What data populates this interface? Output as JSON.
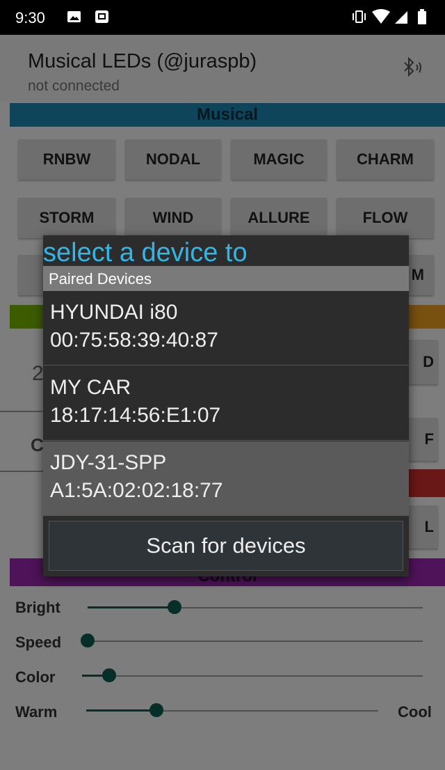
{
  "status_bar": {
    "time": "9:30"
  },
  "app": {
    "title": "Musical LEDs (@juraspb)",
    "subtitle": "not connected",
    "bluetooth_icon": "bluetooth-searching-icon"
  },
  "sections": {
    "musical": "Musical",
    "control": "Control"
  },
  "colors": {
    "musical_band": "#1f8bb5",
    "section2_band": "#7ab800",
    "section2_right": "#f0a020",
    "section3_band": "#d32f2f",
    "control_band": "#9c27b0",
    "slider_accent": "#0b5f50",
    "dialog_title": "#33b5e5"
  },
  "musical_buttons": {
    "row1": [
      "RNBW",
      "NODAL",
      "MAGIC",
      "CHARM"
    ],
    "row2": [
      "STORM",
      "WIND",
      "ALLURE",
      "FLOW"
    ],
    "row3_visible_fragment": "M"
  },
  "partial_fragments": {
    "left_digit": "2",
    "d_button": "D",
    "c_fragment": "C",
    "f_fragment": "F",
    "l_fragment": "L"
  },
  "sliders": [
    {
      "label": "Bright",
      "value": 0.26
    },
    {
      "label": "Speed",
      "value": 0.0
    },
    {
      "label": "Color",
      "value": 0.08
    },
    {
      "label": "Warm",
      "value": 0.24,
      "right_label": "Cool"
    }
  ],
  "dialog": {
    "title": "select a device to",
    "section_header": "Paired Devices",
    "devices": [
      {
        "name": "HYUNDAI i80",
        "address": "00:75:58:39:40:87"
      },
      {
        "name": "MY CAR",
        "address": "18:17:14:56:E1:07"
      },
      {
        "name": "JDY-31-SPP",
        "address": "A1:5A:02:02:18:77"
      }
    ],
    "scan_button": "Scan for devices"
  }
}
